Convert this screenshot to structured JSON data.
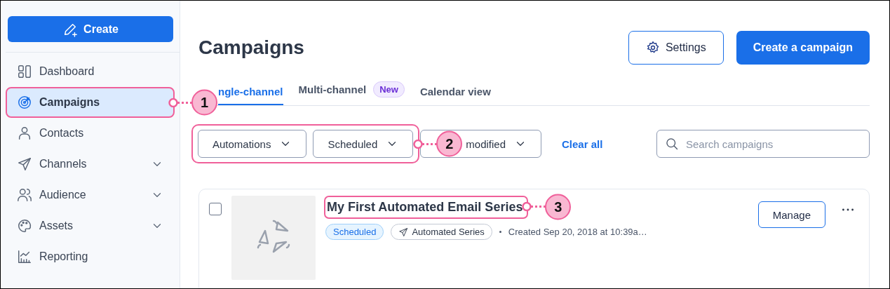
{
  "sidebar": {
    "create_button": "Create",
    "items": [
      {
        "label": "Dashboard",
        "selected": false,
        "expandable": false
      },
      {
        "label": "Campaigns",
        "selected": true,
        "expandable": false,
        "callout": "1"
      },
      {
        "label": "Contacts",
        "selected": false,
        "expandable": false
      },
      {
        "label": "Channels",
        "selected": false,
        "expandable": true
      },
      {
        "label": "Audience",
        "selected": false,
        "expandable": true
      },
      {
        "label": "Assets",
        "selected": false,
        "expandable": true
      },
      {
        "label": "Reporting",
        "selected": false,
        "expandable": false
      }
    ]
  },
  "header": {
    "title": "Campaigns",
    "settings_button": "Settings",
    "create_button": "Create a campaign"
  },
  "tabs": [
    {
      "label": "ngle-channel",
      "selected": true
    },
    {
      "label": "Multi-channel",
      "selected": false,
      "badge": "New"
    },
    {
      "label": "Calendar view",
      "selected": false
    }
  ],
  "filters": {
    "callout": "2",
    "dropdowns": [
      {
        "label": "Automations",
        "highlighted": true
      },
      {
        "label": "Scheduled",
        "highlighted": true
      },
      {
        "label": "modified",
        "highlighted": false
      }
    ],
    "clear_all": "Clear all",
    "search": {
      "placeholder": "Search campaigns"
    }
  },
  "campaigns": [
    {
      "checked": false,
      "title": "My First Automated Email Series",
      "callout": "3",
      "status": "Scheduled",
      "type": "Automated Series",
      "created": "Created Sep 20, 2018 at 10:39a…",
      "action": "Manage"
    }
  ]
}
